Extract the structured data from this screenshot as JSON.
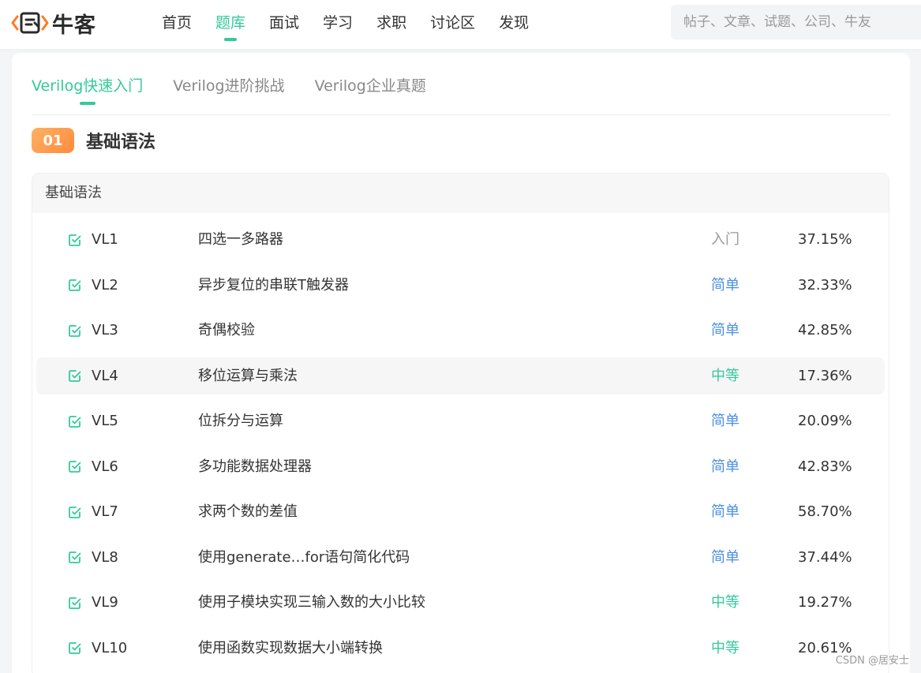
{
  "header": {
    "logo_text": "牛客",
    "nav": [
      "首页",
      "题库",
      "面试",
      "学习",
      "求职",
      "讨论区",
      "发现"
    ],
    "active_nav": 1,
    "search_placeholder": "帖子、文章、试题、公司、牛友"
  },
  "tabs": {
    "items": [
      "Verilog快速入门",
      "Verilog进阶挑战",
      "Verilog企业真题"
    ],
    "active": 0
  },
  "section": {
    "badge": "01",
    "title": "基础语法",
    "panel_header": "基础语法"
  },
  "problems": [
    {
      "id": "VL1",
      "title": "四选一多路器",
      "difficulty": "入门",
      "level": "entry",
      "rate": "37.15%"
    },
    {
      "id": "VL2",
      "title": "异步复位的串联T触发器",
      "difficulty": "简单",
      "level": "easy",
      "rate": "32.33%"
    },
    {
      "id": "VL3",
      "title": "奇偶校验",
      "difficulty": "简单",
      "level": "easy",
      "rate": "42.85%"
    },
    {
      "id": "VL4",
      "title": "移位运算与乘法",
      "difficulty": "中等",
      "level": "medium",
      "rate": "17.36%"
    },
    {
      "id": "VL5",
      "title": "位拆分与运算",
      "difficulty": "简单",
      "level": "easy",
      "rate": "20.09%"
    },
    {
      "id": "VL6",
      "title": "多功能数据处理器",
      "difficulty": "简单",
      "level": "easy",
      "rate": "42.83%"
    },
    {
      "id": "VL7",
      "title": "求两个数的差值",
      "difficulty": "简单",
      "level": "easy",
      "rate": "58.70%"
    },
    {
      "id": "VL8",
      "title": "使用generate…for语句简化代码",
      "difficulty": "简单",
      "level": "easy",
      "rate": "37.44%"
    },
    {
      "id": "VL9",
      "title": "使用子模块实现三输入数的大小比较",
      "difficulty": "中等",
      "level": "medium",
      "rate": "19.27%"
    },
    {
      "id": "VL10",
      "title": "使用函数实现数据大小端转换",
      "difficulty": "中等",
      "level": "medium",
      "rate": "20.61%"
    }
  ],
  "hover_row": 3,
  "watermark": "CSDN @居安士",
  "colors": {
    "accent": "#32ca99",
    "easy": "#4a90e2",
    "entry": "#999999",
    "badge": "#ff9a4a"
  }
}
